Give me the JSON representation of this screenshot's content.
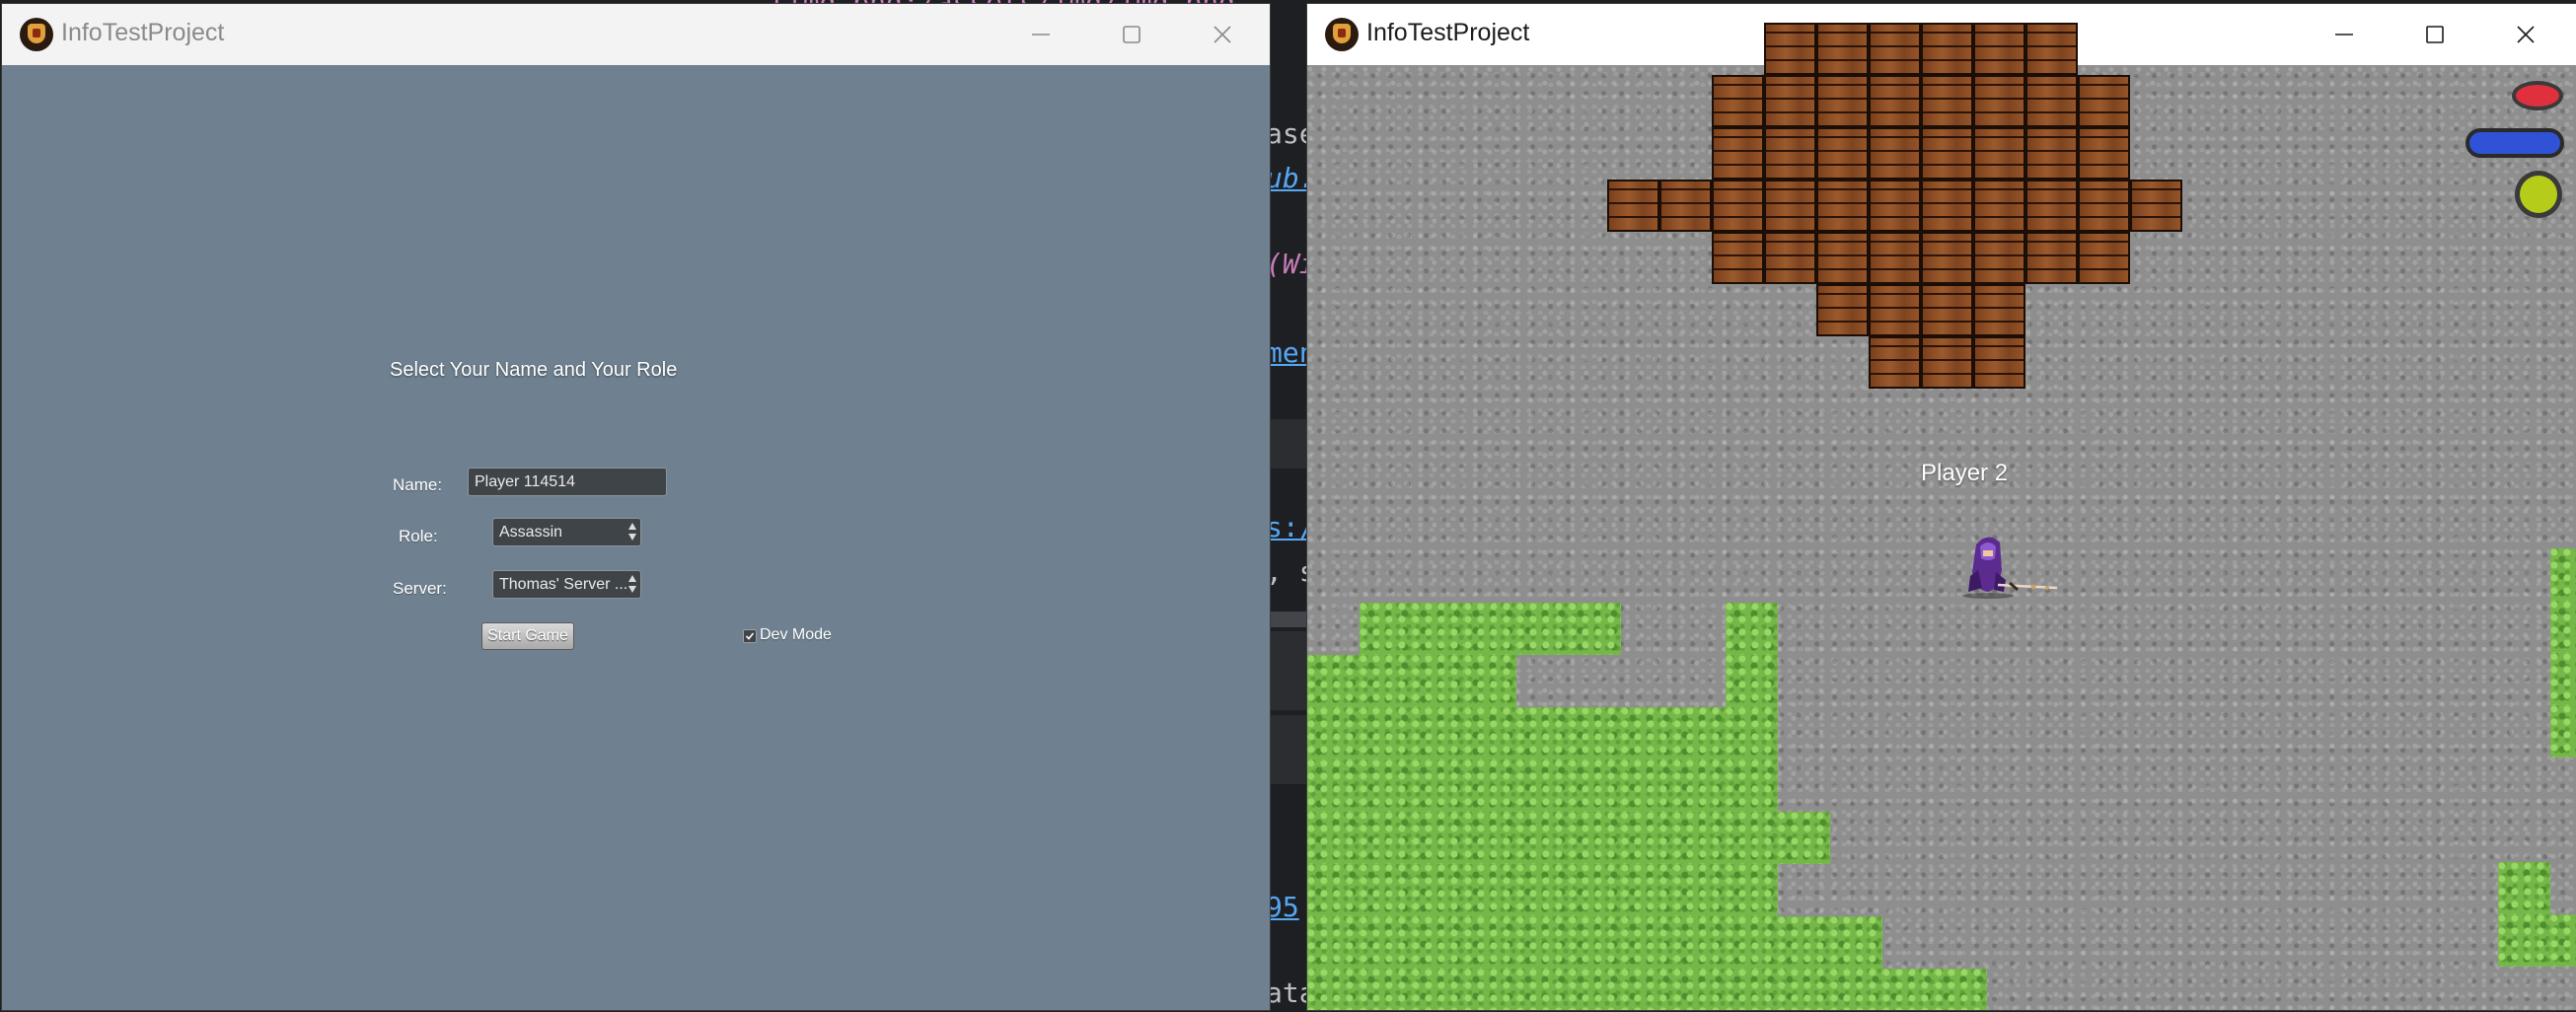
{
  "editor_fragments": [
    {
      "text": "(img.png:/assets/img/img.png",
      "color": "#c77dbb"
    },
    {
      "text": "ase",
      "color": "#bcbec4"
    },
    {
      "text": "ub.",
      "color": "#56a8f5"
    },
    {
      "text": "(Wi",
      "color": "#c77dbb"
    },
    {
      "text": "men",
      "color": "#56a8f5"
    },
    {
      "text": "s:/",
      "color": "#56a8f5"
    },
    {
      "text": ", s",
      "color": "#bcbec4"
    },
    {
      "text": "95",
      "color": "#56a8f5"
    },
    {
      "text": "ata",
      "color": "#bcbec4"
    }
  ],
  "menu_window": {
    "title": "InfoTestProject",
    "icon": "app-icon",
    "controls": [
      "minimize-icon",
      "maximize-icon",
      "close-icon"
    ],
    "heading": "Select Your Name and Your Role",
    "name_label": "Name:",
    "name_value": "Player 114514",
    "role_label": "Role:",
    "role_value": "Assassin",
    "server_label": "Server:",
    "server_value": "Thomas' Server ...",
    "start_label": "Start Game",
    "dev_mode_label": "Dev Mode",
    "dev_mode_checked": true,
    "background": "#6f8190"
  },
  "game_window": {
    "title": "InfoTestProject",
    "icon": "app-icon",
    "controls": [
      "minimize-icon",
      "maximize-icon",
      "close-icon"
    ],
    "player_label": "Player 2",
    "hud_colors": {
      "health": "#e0303e",
      "mana": "#2f52d6",
      "stamina": "#b6cc1a"
    }
  }
}
